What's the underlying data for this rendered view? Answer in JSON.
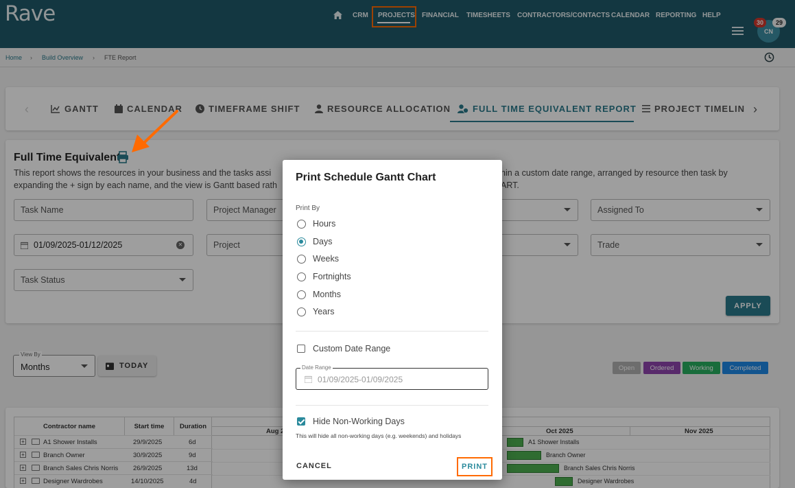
{
  "app": {
    "logo": "Rave"
  },
  "nav": {
    "items": [
      "CRM",
      "PROJECTS",
      "FINANCIAL",
      "TIMESHEETS",
      "CONTRACTORS/CONTACTS",
      "CALENDAR",
      "REPORTING",
      "HELP"
    ],
    "active": "PROJECTS",
    "notifications_red": "30",
    "notifications_white": "29",
    "avatar_initials": "CN"
  },
  "breadcrumb": {
    "home": "Home",
    "parent": "Build Overview",
    "current": "FTE Report"
  },
  "tabs": {
    "items": [
      "GANTT",
      "CALENDAR",
      "TIMEFRAME SHIFT",
      "RESOURCE ALLOCATION",
      "FULL TIME EQUIVALENT REPORT",
      "PROJECT TIMELIN"
    ],
    "active": "FULL TIME EQUIVALENT REPORT"
  },
  "report": {
    "title": "Full Time Equivalent",
    "desc_line1": "This report shows the resources in your business and the tasks assi",
    "desc_line1_right": "hin a custom date range, arranged by resource then task by",
    "desc_line2": "expanding the + sign by each name, and the view is Gantt based rath",
    "desc_line2_right": "ART."
  },
  "filters": {
    "task_name": "Task Name",
    "project_manager": "Project Manager",
    "assigned_to": "Assigned To",
    "date_range": "01/09/2025-01/12/2025",
    "project": "Project",
    "trade": "Trade",
    "task_status": "Task Status",
    "apply": "APPLY"
  },
  "viewby": {
    "label": "View By",
    "value": "Months",
    "today": "TODAY"
  },
  "legend": [
    {
      "label": "Open",
      "color": "#b0b0b0"
    },
    {
      "label": "Ordered",
      "color": "#8e44ad"
    },
    {
      "label": "Working",
      "color": "#27ae60"
    },
    {
      "label": "Completed",
      "color": "#1e88e5"
    }
  ],
  "gantt": {
    "headers": {
      "name": "Contractor name",
      "start": "Start time",
      "duration": "Duration"
    },
    "months": [
      "Aug 2",
      "Oct 2025",
      "Nov 2025"
    ],
    "rows": [
      {
        "name": "A1 Shower Installs",
        "start": "29/9/2025",
        "duration": "6d",
        "bar_label": "A1 Shower Installs"
      },
      {
        "name": "Branch Owner",
        "start": "30/9/2025",
        "duration": "9d",
        "bar_label": "Branch Owner"
      },
      {
        "name": "Branch Sales Chris Norris",
        "start": "26/9/2025",
        "duration": "13d",
        "bar_label": "Branch Sales Chris Norris"
      },
      {
        "name": "Designer Wardrobes",
        "start": "14/10/2025",
        "duration": "4d",
        "bar_label": "Designer Wardrobes"
      }
    ]
  },
  "dialog": {
    "title": "Print Schedule Gantt Chart",
    "print_by_label": "Print By",
    "options": [
      "Hours",
      "Days",
      "Weeks",
      "Fortnights",
      "Months",
      "Years"
    ],
    "selected": "Days",
    "custom_range_label": "Custom Date Range",
    "custom_range_checked": false,
    "date_range_label": "Date Range",
    "date_range_value": "01/09/2025-01/09/2025",
    "hide_nonworking_label": "Hide Non-Working Days",
    "hide_nonworking_checked": true,
    "hint": "This will hide all non-working days (e.g. weekends) and holidays",
    "cancel": "CANCEL",
    "print": "PRINT"
  },
  "colors": {
    "header_bg": "#1f5a6a",
    "accent": "#2a7a8c",
    "highlight": "#ff6a00"
  }
}
